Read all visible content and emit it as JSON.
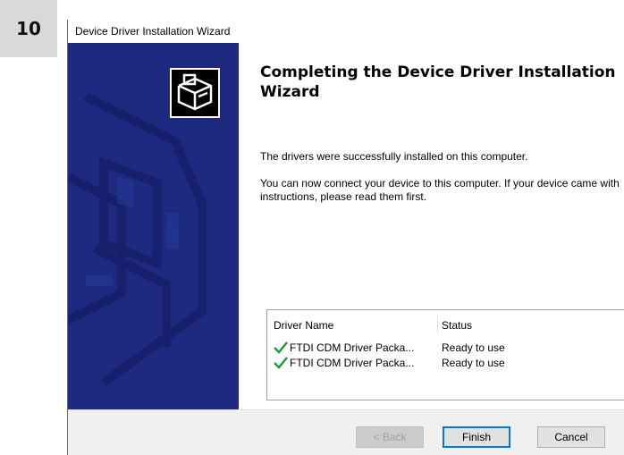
{
  "step_badge": "10",
  "window": {
    "title": "Device Driver Installation Wizard"
  },
  "content": {
    "heading": "Completing the Device Driver Installation Wizard",
    "message1": "The drivers were successfully installed on this computer.",
    "message2": "You can now connect your device to this computer. If your device came with instructions, please read them first."
  },
  "driver_table": {
    "columns": [
      "Driver Name",
      "Status"
    ],
    "rows": [
      {
        "name": "FTDI CDM Driver Packa...",
        "status": "Ready to use",
        "icon": "green-check-icon"
      },
      {
        "name": "FTDI CDM Driver Packa...",
        "status": "Ready to use",
        "icon": "green-check-icon"
      }
    ]
  },
  "buttons": {
    "back": "< Back",
    "finish": "Finish",
    "cancel": "Cancel"
  },
  "colors": {
    "side_panel": "#1d2a80",
    "window_border": "#1883d7",
    "check": "#1a9c2a",
    "default_button_border": "#0078d7"
  }
}
